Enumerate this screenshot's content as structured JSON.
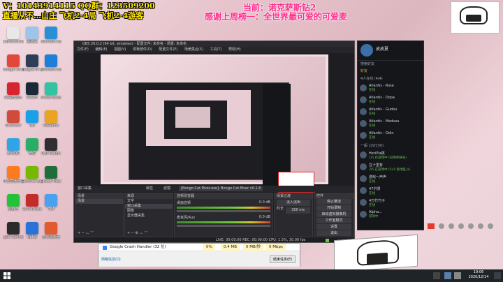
{
  "overlay": {
    "contact_line1": "V：10143914115 QQ群：123509200",
    "contact_line2": "直播从不…山庄 飞机2-4局  飞机2-4游客",
    "current_label": "当前：诺克萨斯钻2",
    "thanks_line": "感谢上周榜一：全世界最可爱的可爱麦"
  },
  "desktop_icons": [
    {
      "label": "Administrator",
      "color": "#e8e8e8"
    },
    {
      "label": "回收站",
      "color": "#9fc4ea"
    },
    {
      "label": "Microsoft Edge",
      "color": "#2b8fd6"
    },
    {
      "label": "Google Chrome",
      "color": "#e2473a"
    },
    {
      "label": "League of Legends",
      "color": "#2c3f57"
    },
    {
      "label": "Microsoft Edge",
      "color": "#1c7fd8"
    },
    {
      "label": "网易云音乐",
      "color": "#d8242c"
    },
    {
      "label": "Steam",
      "color": "#1b2838"
    },
    {
      "label": "StreamLabs",
      "color": "#31c3a2"
    },
    {
      "label": "Overwolf",
      "color": "#d24a3a"
    },
    {
      "label": "QQ",
      "color": "#1aa0e8"
    },
    {
      "label": "WeGame",
      "color": "#e9a422"
    },
    {
      "label": "腾讯QQ",
      "color": "#2fa4e7"
    },
    {
      "label": "微信",
      "color": "#2aae67"
    },
    {
      "label": "OBS Studio",
      "color": "#302e31"
    },
    {
      "label": "斗鱼直播伴侣",
      "color": "#ff7a1a"
    },
    {
      "label": "GeForce Exp",
      "color": "#76b900"
    },
    {
      "label": "Grand Theft Auto V",
      "color": "#1d6e3a"
    },
    {
      "label": "爱奇艺",
      "color": "#24c239"
    },
    {
      "label": "WPS Office",
      "color": "#c42b2b"
    },
    {
      "label": "TIM",
      "color": "#4aa1f0"
    },
    {
      "label": "Epic Games",
      "color": "#2b2b2b"
    },
    {
      "label": "Uplay",
      "color": "#2872d8"
    },
    {
      "label": "游戏加速器",
      "color": "#e25b2f"
    }
  ],
  "obs": {
    "title": "OBS 26.0.2 (64 bit, windows) - 配置文件: 未命名 - 场景: 未命名",
    "menu": [
      "文件(F)",
      "编辑(E)",
      "视图(V)",
      "停靠部件(D)",
      "配置文件(P)",
      "场景集合(S)",
      "工具(T)",
      "帮助(H)"
    ],
    "scenes_header": "场景",
    "scenes": [
      "场景"
    ],
    "sources_header": "来源",
    "sources": [
      "文字",
      "窗口采集",
      "图像",
      "显示器采集"
    ],
    "mixer_header": "音频混音器",
    "mixer": [
      {
        "name": "桌面音频",
        "db": "0.0 dB"
      },
      {
        "name": "麦克风/Aux",
        "db": "0.0 dB"
      }
    ],
    "transition_header": "场景过渡",
    "transition_items": [
      "淡入淡出",
      "时长",
      "300 ms"
    ],
    "controls_header": "控件",
    "controls": [
      "停止推流",
      "开始录制",
      "启动虚拟摄像机",
      "工作室模式",
      "设置",
      "退出"
    ],
    "status": "LIVE: 00:00:00  REC: 00:00:00  CPU: 1.5%, 30.00 fps",
    "preview_label": "窗口采集",
    "prop_btn": "属性",
    "filter_btn": "滤镜",
    "source_select": "[Bongo Cat Mver.exe]: Bongo Cat Mver v0.1.6"
  },
  "chat": {
    "user_name": "皮皮夏",
    "tab_label": "好友",
    "search_placeholder": "搜索好友",
    "groups": [
      "4人在线 (4/4)",
      "一般 (19/156)"
    ],
    "friends": [
      {
        "name": "Atlantis - Rose",
        "status": "在线"
      },
      {
        "name": "Atlantis - Dopa",
        "status": "在线"
      },
      {
        "name": "Atlantis - Gudou",
        "status": "在线"
      },
      {
        "name": "Atlantis - Medusa",
        "status": "在线"
      },
      {
        "name": "Atlantis - Odin",
        "status": "在线"
      },
      {
        "name": "HeriPia跳",
        "status": "1/5 在游戏中 (召唤师峡谷)"
      },
      {
        "name": "在十里有",
        "status": "3/5 在游戏中 (5v5 极地乱斗)"
      },
      {
        "name": "游戏一声声",
        "status": "在线"
      },
      {
        "name": "47洪漫",
        "status": "在线"
      },
      {
        "name": "4万竹竹子",
        "status": "在线"
      },
      {
        "name": "Alpha...",
        "status": "游戏中"
      }
    ]
  },
  "taskmgr": {
    "row_name": "Google Crash Handler (32 位)",
    "cpu": "0%",
    "mem": "0.4 MB",
    "disk": "0 MB/秒",
    "net": "0 Mbps",
    "fewer_details": "简略信息(D)",
    "end_task": "结束任务(E)"
  },
  "taskbar": {
    "time": "19:06",
    "date": "2020/12/14",
    "search_placeholder": "在这里输入你要搜索的内容"
  },
  "colors": {
    "accent_green": "#6ec93a",
    "live_red": "#c93b2f",
    "chat_bg": "#14161a"
  }
}
